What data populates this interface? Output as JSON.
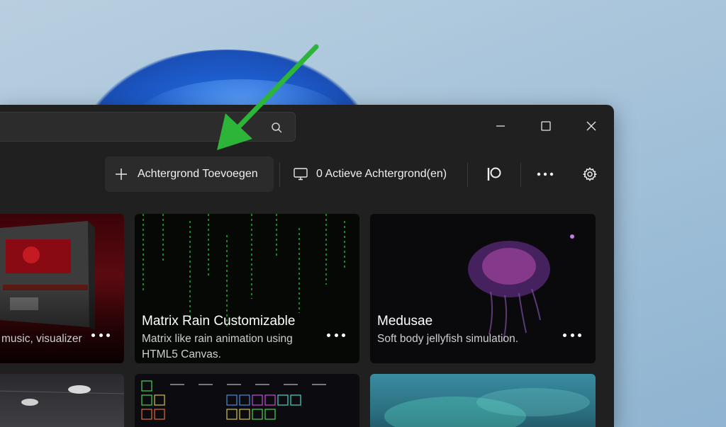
{
  "toolbar": {
    "add_label": "Achtergrond Toevoegen",
    "active_label": "0 Actieve Achtergrond(en)"
  },
  "search": {
    "placeholder": ""
  },
  "cards": [
    {
      "title": "",
      "description": "music, visualizer"
    },
    {
      "title": "Matrix Rain Customizable",
      "description": "Matrix like rain animation using HTML5 Canvas."
    },
    {
      "title": "Medusae",
      "description": "Soft body jellyfish simulation."
    }
  ],
  "colors": {
    "accent_arrow": "#2db53a",
    "window_bg": "#202020"
  },
  "icons": [
    "search-icon",
    "minimize-icon",
    "maximize-icon",
    "close-icon",
    "plus-icon",
    "monitor-icon",
    "patreon-icon",
    "more-icon",
    "gear-icon"
  ]
}
